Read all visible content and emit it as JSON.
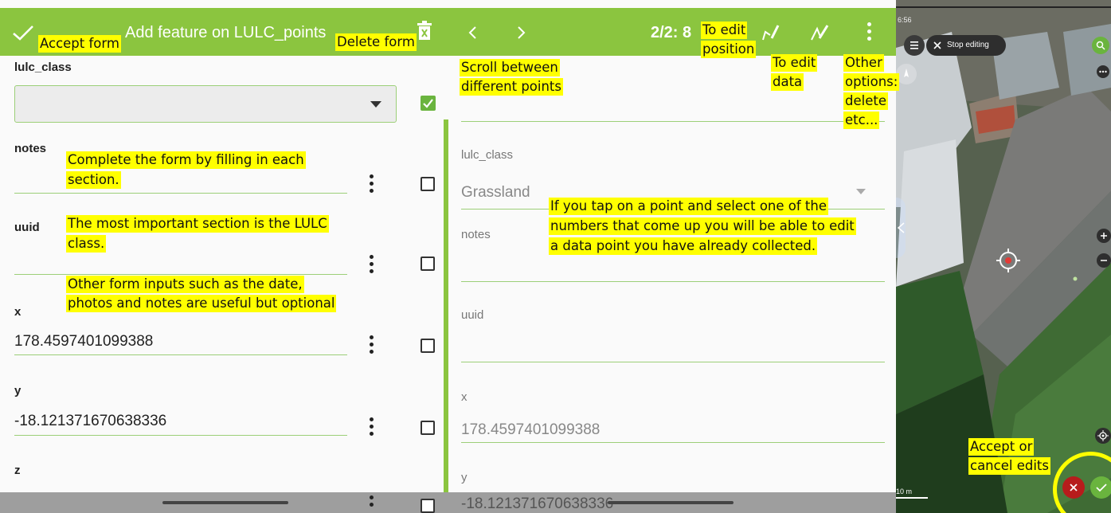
{
  "form_panel": {
    "title": "Add feature on LULC_points",
    "fields": {
      "lulc_class_label": "lulc_class",
      "notes_label": "notes",
      "uuid_label": "uuid",
      "x_label": "x",
      "x_value": "178.4597401099388",
      "y_label": "y",
      "y_value": "-18.121371670638336",
      "z_label": "z"
    }
  },
  "browse_panel": {
    "counter": "2/2: 8",
    "fields": {
      "lulc_class_label": "lulc_class",
      "lulc_class_value": "Grassland",
      "notes_label": "notes",
      "uuid_label": "uuid",
      "x_label": "x",
      "x_value": "178.4597401099388",
      "y_label": "y",
      "y_value": "-18.121371670638336"
    }
  },
  "map_panel": {
    "clock": "6:56",
    "stop_editing_label": "Stop editing",
    "scale_label": "10 m"
  },
  "annotations": {
    "accept_form": "Accept form",
    "delete_form": "Delete form",
    "complete_line1": "Complete the form by filling in each",
    "complete_line2": "section.",
    "important_line1": "The most important section is the LULC",
    "important_line2": "class.",
    "other_inputs_line1": "Other form inputs such as the date,",
    "other_inputs_line2": "photos and notes are useful but optional",
    "scroll_line1": "Scroll between",
    "scroll_line2": "different points",
    "edit_position_line1": "To edit",
    "edit_position_line2": "position",
    "edit_data_line1": "To edit",
    "edit_data_line2": "data",
    "other_options_line1": "Other",
    "other_options_line2": "options:",
    "other_options_line3": "delete",
    "other_options_line4": "etc...",
    "tap_line1": "If you tap on a point and select one of the",
    "tap_line2": "numbers that come up you will be able to edit",
    "tap_line3": "a data point you have already collected.",
    "accept_cancel_line1": "Accept or",
    "accept_cancel_line2": "cancel edits"
  },
  "colors": {
    "toolbar_green": "#8bc53f",
    "highlight_yellow": "#ffff00",
    "cancel_red": "#b71c1c",
    "accept_green": "#6ab43e"
  }
}
